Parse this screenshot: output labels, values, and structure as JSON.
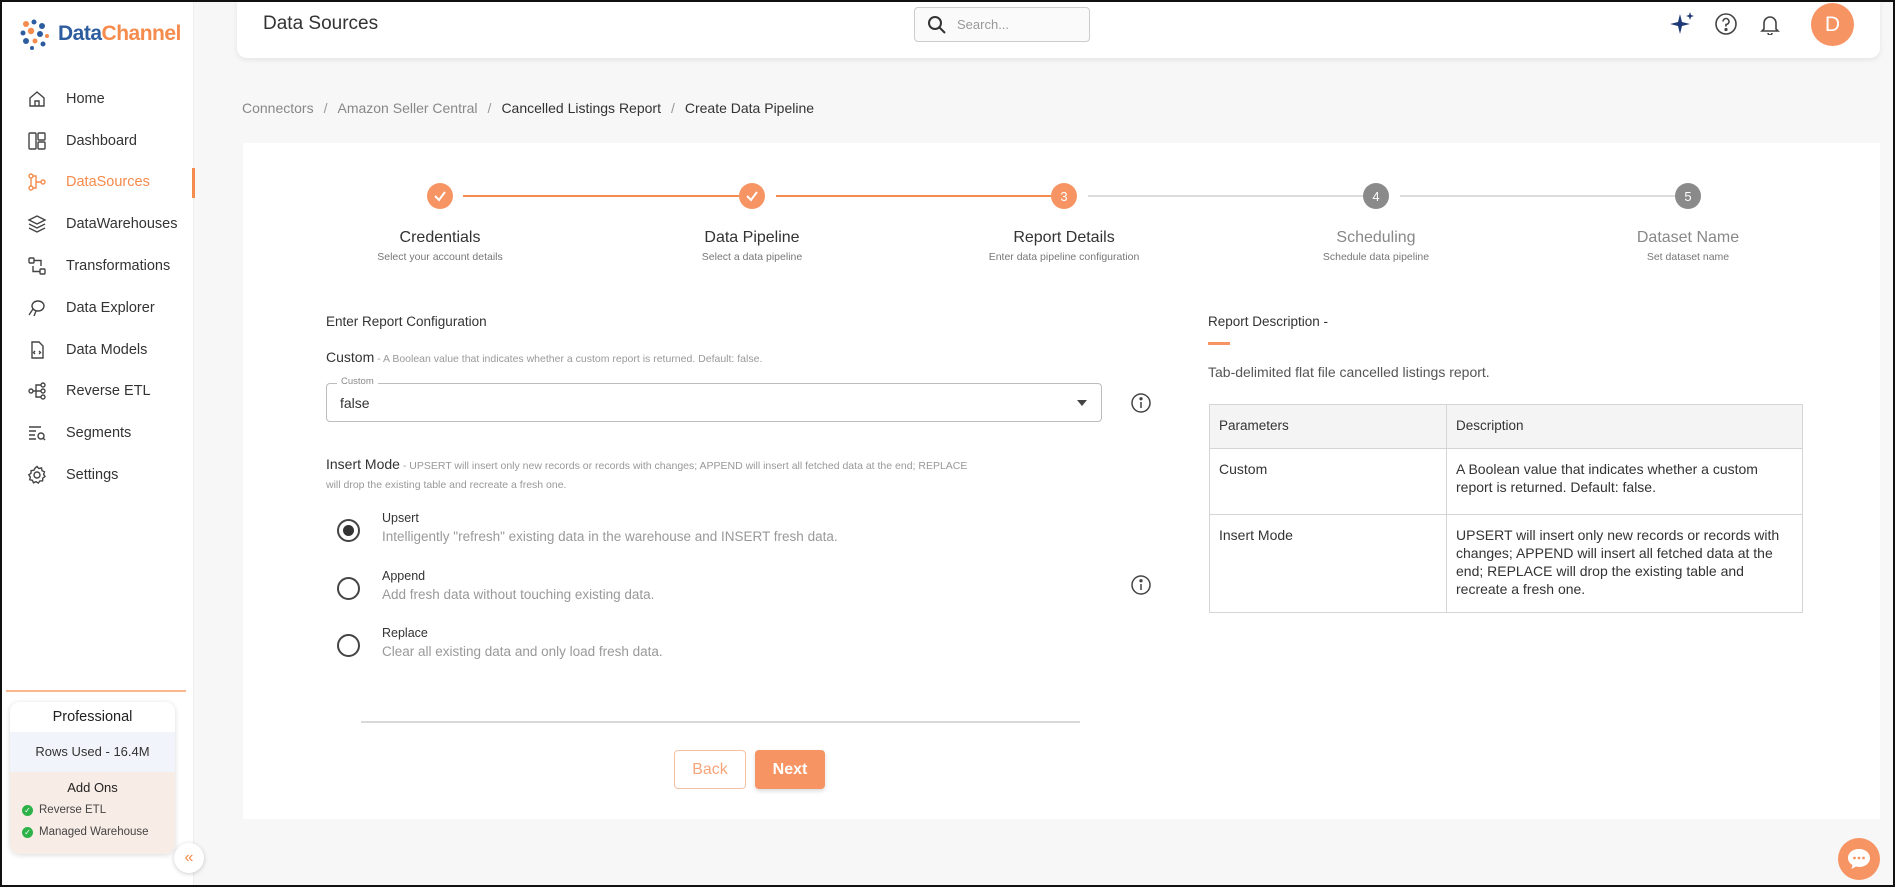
{
  "app": {
    "logo_text_data": "Data",
    "logo_text_channel": "Channel",
    "header_title": "Data Sources",
    "search_placeholder": "Search...",
    "avatar_initial": "D"
  },
  "sidebar": {
    "items": [
      {
        "label": "Home",
        "icon": "home-icon"
      },
      {
        "label": "Dashboard",
        "icon": "dashboard-icon"
      },
      {
        "label": "DataSources",
        "icon": "datasources-icon",
        "active": true
      },
      {
        "label": "DataWarehouses",
        "icon": "datawarehouses-icon"
      },
      {
        "label": "Transformations",
        "icon": "transformations-icon"
      },
      {
        "label": "Data Explorer",
        "icon": "data-explorer-icon"
      },
      {
        "label": "Data Models",
        "icon": "data-models-icon"
      },
      {
        "label": "Reverse ETL",
        "icon": "reverse-etl-icon"
      },
      {
        "label": "Segments",
        "icon": "segments-icon"
      },
      {
        "label": "Settings",
        "icon": "settings-icon"
      }
    ],
    "plan": {
      "title": "Professional",
      "rows_used": "Rows Used - 16.4M",
      "addons_title": "Add Ons",
      "addons": [
        "Reverse ETL",
        "Managed Warehouse"
      ]
    }
  },
  "breadcrumb": [
    "Connectors",
    "Amazon Seller Central",
    "Cancelled Listings Report",
    "Create Data Pipeline"
  ],
  "stepper": {
    "steps": [
      {
        "title": "Credentials",
        "subtitle": "Select your account details",
        "state": "done",
        "number": "1"
      },
      {
        "title": "Data Pipeline",
        "subtitle": "Select a data pipeline",
        "state": "done",
        "number": "2"
      },
      {
        "title": "Report Details",
        "subtitle": "Enter data pipeline configuration",
        "state": "active",
        "number": "3"
      },
      {
        "title": "Scheduling",
        "subtitle": "Schedule data pipeline",
        "state": "pending",
        "number": "4"
      },
      {
        "title": "Dataset Name",
        "subtitle": "Set dataset name",
        "state": "pending",
        "number": "5"
      }
    ]
  },
  "form": {
    "section_title": "Enter Report Configuration",
    "custom": {
      "label": "Custom",
      "hint": " - A Boolean value that indicates whether a custom report is returned. Default: false.",
      "field_label": "Custom",
      "value": "false"
    },
    "insert_mode": {
      "label": "Insert Mode",
      "hint": " - UPSERT will insert only new records or records with changes; APPEND will insert all fetched data at the end; REPLACE",
      "hint2": "will drop the existing table and recreate a fresh one.",
      "options": [
        {
          "label": "Upsert",
          "description": "Intelligently \"refresh\" existing data in the warehouse and INSERT fresh data.",
          "selected": true
        },
        {
          "label": "Append",
          "description": "Add fresh data without touching existing data.",
          "selected": false
        },
        {
          "label": "Replace",
          "description": "Clear all existing data and only load fresh data.",
          "selected": false
        }
      ]
    },
    "back_label": "Back",
    "next_label": "Next"
  },
  "description": {
    "title": "Report Description -",
    "text": "Tab-delimited flat file cancelled listings report.",
    "table": {
      "headers": [
        "Parameters",
        "Description"
      ],
      "rows": [
        [
          "Custom",
          "A Boolean value that indicates whether a custom report is returned. Default: false."
        ],
        [
          "Insert Mode",
          "UPSERT will insert only new records or records with changes; APPEND will insert all fetched data at the end; REPLACE will drop the existing table and recreate a fresh one."
        ]
      ]
    }
  },
  "colors": {
    "accent": "#f79463",
    "done_line": "#f58b4c",
    "pending": "#8a8a8a",
    "check_green": "#2db24a"
  }
}
